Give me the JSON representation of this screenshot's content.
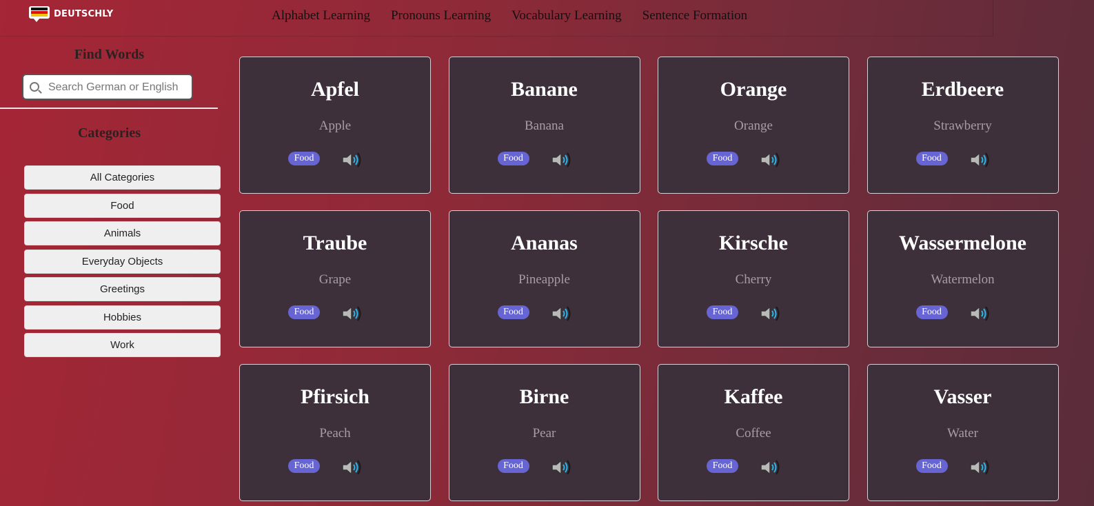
{
  "brand": {
    "name": "DEUTSCHLY"
  },
  "nav": {
    "items": [
      "Alphabet Learning",
      "Pronouns Learning",
      "Vocabulary Learning",
      "Sentence Formation"
    ]
  },
  "sidebar": {
    "find_title": "Find Words",
    "search_placeholder": "Search German or English",
    "categories_title": "Categories",
    "categories": [
      "All Categories",
      "Food",
      "Animals",
      "Everyday Objects",
      "Greetings",
      "Hobbies",
      "Work"
    ]
  },
  "cards": [
    {
      "german": "Apfel",
      "english": "Apple",
      "category": "Food"
    },
    {
      "german": "Banane",
      "english": "Banana",
      "category": "Food"
    },
    {
      "german": "Orange",
      "english": "Orange",
      "category": "Food"
    },
    {
      "german": "Erdbeere",
      "english": "Strawberry",
      "category": "Food"
    },
    {
      "german": "Traube",
      "english": "Grape",
      "category": "Food"
    },
    {
      "german": "Ananas",
      "english": "Pineapple",
      "category": "Food"
    },
    {
      "german": "Kirsche",
      "english": "Cherry",
      "category": "Food"
    },
    {
      "german": "Wassermelone",
      "english": "Watermelon",
      "category": "Food"
    },
    {
      "german": "Pfirsich",
      "english": "Peach",
      "category": "Food"
    },
    {
      "german": "Birne",
      "english": "Pear",
      "category": "Food"
    },
    {
      "german": "Kaffee",
      "english": "Coffee",
      "category": "Food"
    },
    {
      "german": "Vasser",
      "english": "Water",
      "category": "Food"
    }
  ],
  "icons": {
    "speaker": "speaker-icon",
    "search": "search-icon",
    "logo": "german-flag-speech-icon"
  },
  "colors": {
    "badge": "#6764d4",
    "card_bg": "#3d303b",
    "accent_wave": "#29b6e8"
  }
}
